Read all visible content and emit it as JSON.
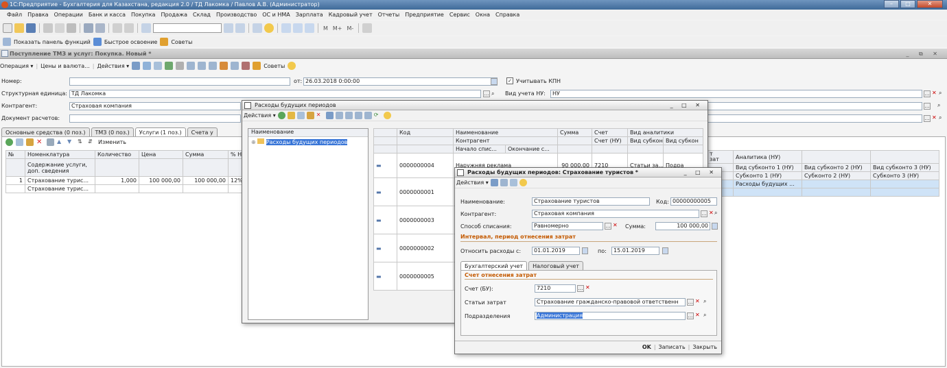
{
  "app": {
    "title": "1С:Предприятие - Бухгалтерия для Казахстана, редакция 2.0 / ТД Лакомка / Павлов А.В. (Администратор)"
  },
  "menu": [
    "Файл",
    "Правка",
    "Операции",
    "Банк и касса",
    "Покупка",
    "Продажа",
    "Склад",
    "Производство",
    "ОС и НМА",
    "Зарплата",
    "Кадровый учет",
    "Отчеты",
    "Предприятие",
    "Сервис",
    "Окна",
    "Справка"
  ],
  "toolbar2": {
    "show_panel": "Показать панель функций",
    "quick_learn": "Быстрое освоение",
    "tips": "Советы"
  },
  "toolbar1": {
    "calc": [
      "M",
      "M+",
      "M-"
    ]
  },
  "document": {
    "title": "Поступление ТМЗ и услуг: Покупка. Новый *",
    "toolbar": {
      "operation": "Операция",
      "prices": "Цены и валюта...",
      "actions": "Действия",
      "tips": "Советы"
    },
    "number_label": "Номер:",
    "number_value": "",
    "date_label": "от:",
    "date_value": "26.03.2018 0:00:00",
    "kpn_label": "Учитывать КПН",
    "unit_label": "Структурная единица:",
    "unit_value": "ТД Лакомка",
    "nu_label": "Вид учета НУ:",
    "nu_value": "НУ",
    "contractor_label": "Контрагент:",
    "contractor_value": "Страховая компания",
    "settlement_label": "Документ расчетов:",
    "settlement_value": "",
    "tabs": [
      "Основные средства (0 поз.)",
      "ТМЗ (0 поз.)",
      "Услуги (1 поз.)",
      "Счета у"
    ],
    "tab_actions": {
      "edit": "Изменить"
    },
    "grid": {
      "headers": [
        "№",
        "Номенклатура",
        "Количество",
        "Цена",
        "Сумма",
        "% Н"
      ],
      "subheader": "Содержание услуги, доп. сведения",
      "rows": [
        {
          "n": "1",
          "item": "Страхование турис...",
          "qty": "1,000",
          "price": "100 000,00",
          "sum": "100 000,00",
          "pct": "12%",
          "desc": "Страхование турис..."
        }
      ]
    },
    "right_grid": {
      "headers": [
        "Аналитика (НУ)",
        "Вид субконто 1 (НУ)",
        "Вид субконто 2 (НУ)",
        "Вид субконто 3 (НУ)"
      ],
      "subheaders": [
        "Субконто 1 (НУ)",
        "Субконто 2 (НУ)",
        "Субконто 3 (НУ)"
      ],
      "partial_header": "т\nзат",
      "row": [
        "Расходы будущих ...",
        "",
        ""
      ]
    }
  },
  "rbp_list": {
    "title": "Расходы будущих периодов",
    "actions": "Действия",
    "tree_header": "Наименование",
    "tree_item": "Расходы будущих периодов",
    "columns": {
      "code": "Код",
      "name": "Наименование",
      "sum": "Сумма",
      "account": "Счет",
      "analytics": "Вид аналитики",
      "contractor": "Контрагент",
      "account_nu": "Счет (НУ)",
      "subkonto": "Вид субконто ...",
      "subkonto2": "Вид субкон",
      "start": "Начало спис...",
      "end": "Окончание с..."
    },
    "rows": [
      {
        "code": "0000000004",
        "name": "Наружняя реклама",
        "sum": "90 000,00",
        "account": "7210",
        "analytics": "Статьи за...",
        "extra": "Подра"
      },
      {
        "code": "0000000001",
        "name": "",
        "sum": "",
        "account": "",
        "analytics": "",
        "extra": ""
      },
      {
        "code": "0000000003",
        "name": "",
        "sum": "",
        "account": "",
        "analytics": "",
        "extra": ""
      },
      {
        "code": "0000000002",
        "name": "",
        "sum": "",
        "account": "",
        "analytics": "",
        "extra": ""
      },
      {
        "code": "0000000005",
        "name": "",
        "sum": "",
        "account": "",
        "analytics": "",
        "extra": ""
      }
    ]
  },
  "rbp_item": {
    "title": "Расходы будущих периодов: Страхование туристов *",
    "actions": "Действия",
    "name_label": "Наименование:",
    "name_value": "Страхование туристов",
    "code_label": "Код:",
    "code_value": "00000000005",
    "contractor_label": "Контрагент:",
    "contractor_value": "Страховая компания",
    "method_label": "Способ списания:",
    "method_value": "Равномерно",
    "sum_label": "Сумма:",
    "sum_value": "100 000,00",
    "interval_header": "Интервал, период отнесения затрат",
    "from_label": "Относить расходы с:",
    "from_value": "01.01.2019",
    "to_label": "по:",
    "to_value": "15.01.2019",
    "tabs": [
      "Бухгалтерский учет",
      "Налоговый учет"
    ],
    "account_header": "Счет отнесения затрат",
    "account_label": "Счет (БУ):",
    "account_value": "7210",
    "cost_label": "Статьи затрат",
    "cost_value": "Страхование гражданско-правовой ответственн",
    "dept_label": "Подразделения",
    "dept_value": "Администрация",
    "ok": "OK",
    "save": "Записать",
    "close": "Закрыть"
  }
}
